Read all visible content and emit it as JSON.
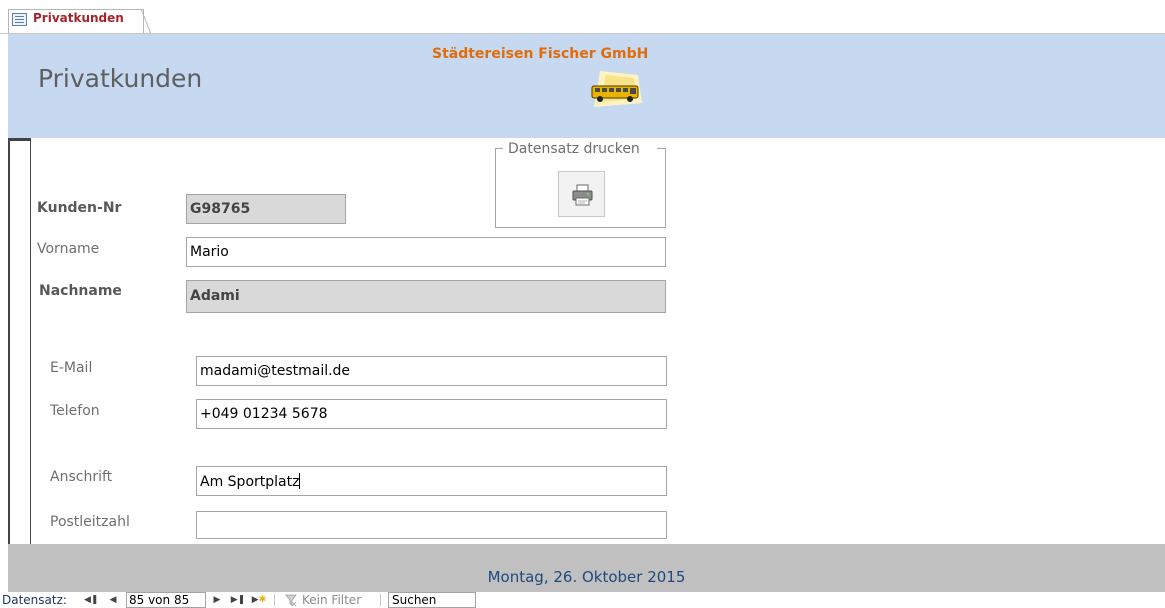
{
  "tab": {
    "label": "Privatkunden",
    "icon": "form-icon"
  },
  "header": {
    "title": "Privatkunden",
    "company": "Städtereisen Fischer GmbH",
    "logo": "bus-icon"
  },
  "print_group": {
    "label": "Datensatz drucken",
    "icon": "printer-icon"
  },
  "fields": {
    "kunden_nr": {
      "label": "Kunden-Nr",
      "value": "G98765"
    },
    "vorname": {
      "label": "Vorname",
      "value": "Mario"
    },
    "nachname": {
      "label": "Nachname",
      "value": "Adami"
    },
    "email": {
      "label": "E-Mail",
      "value": "madami@testmail.de"
    },
    "telefon": {
      "label": "Telefon",
      "value": "+049 01234 5678"
    },
    "anschrift": {
      "label": "Anschrift",
      "value": "Am Sportplatz"
    },
    "postleitzahl": {
      "label": "Postleitzahl",
      "value": ""
    }
  },
  "footer": {
    "date": "Montag, 26. Oktober 2015"
  },
  "navigation": {
    "label": "Datensatz:",
    "record": "85 von 85",
    "filter": "Kein Filter",
    "search": "Suchen"
  },
  "colors": {
    "header_bg": "#c6d9f0",
    "company": "#e36c09",
    "tab_label": "#a4262c",
    "footer_bg": "#c0c0c0",
    "footer_text": "#1f497d"
  }
}
